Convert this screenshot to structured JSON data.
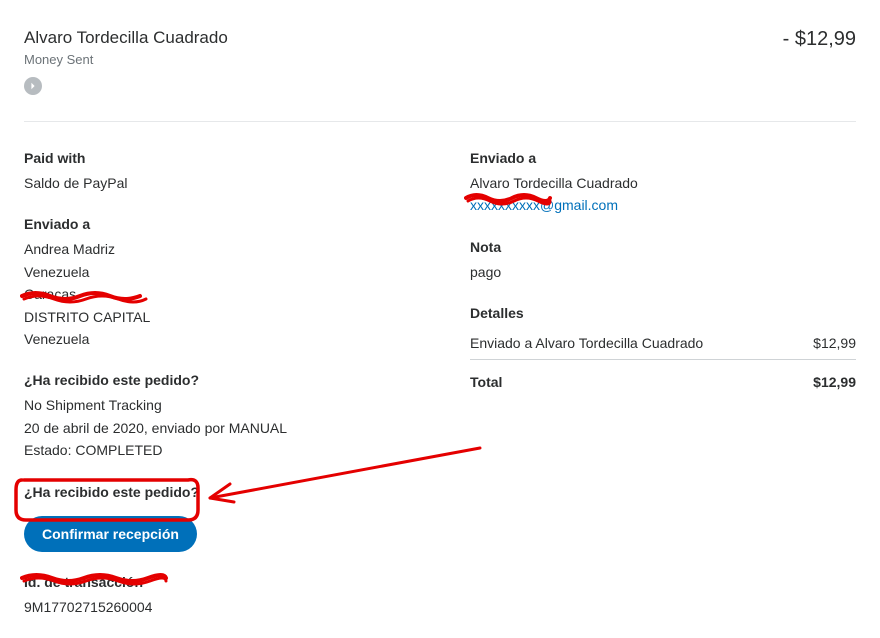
{
  "header": {
    "recipient_name": "Alvaro Tordecilla Cuadrado",
    "status": "Money Sent",
    "amount": "- $12,99"
  },
  "left": {
    "paid_with_h": "Paid with",
    "paid_with_v": "Saldo de PayPal",
    "ship_to_h": "Enviado a",
    "addr_name": "Andrea Madriz",
    "addr_country1": "Venezuela",
    "addr_city": "Caracas",
    "addr_redacted": "DISTRITO CAPITAL",
    "addr_country2": "Venezuela",
    "received_h1": "¿Ha recibido este pedido?",
    "tracking_none": "No Shipment Tracking",
    "tracking_date": "20 de abril de 2020, enviado por MANUAL",
    "tracking_state": "Estado: COMPLETED",
    "received_h2": "¿Ha recibido este pedido?",
    "confirm_btn": "Confirmar recepción",
    "txn_h": "Id. de transacción",
    "txn_id": "9M17702715260004"
  },
  "right": {
    "sent_to_h": "Enviado a",
    "sent_to_name": "Alvaro Tordecilla Cuadrado",
    "email_redacted_prefix": "xxxxxxxxxx",
    "email_visible_suffix": "@gmail.com",
    "note_h": "Nota",
    "note_v": "pago",
    "details_h": "Detalles",
    "detail_label": "Enviado a Alvaro Tordecilla Cuadrado",
    "detail_amount": "$12,99",
    "total_label": "Total",
    "total_amount": "$12,99"
  }
}
